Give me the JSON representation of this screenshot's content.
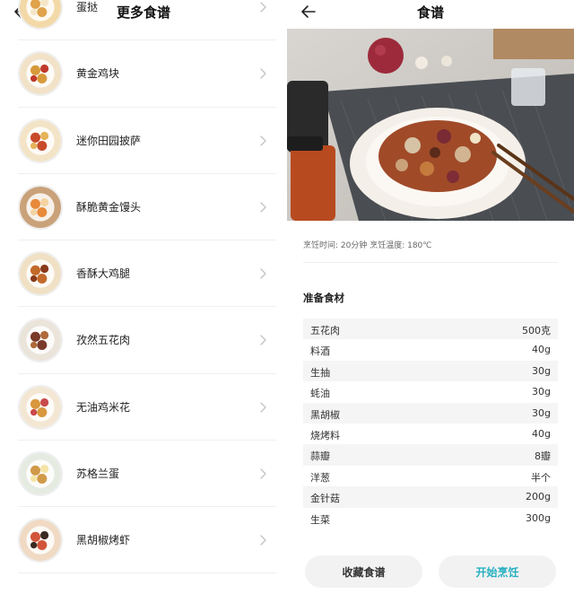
{
  "left": {
    "title": "更多食谱",
    "recipes": [
      {
        "label": "蛋挞",
        "thumb": "egg-tart"
      },
      {
        "label": "黄金鸡块",
        "thumb": "chicken-nuggets"
      },
      {
        "label": "迷你田园披萨",
        "thumb": "mini-pizza"
      },
      {
        "label": "酥脆黄金馒头",
        "thumb": "fried-buns"
      },
      {
        "label": "香酥大鸡腿",
        "thumb": "chicken-drumsticks"
      },
      {
        "label": "孜然五花肉",
        "thumb": "cumin-pork"
      },
      {
        "label": "无油鸡米花",
        "thumb": "popcorn-chicken"
      },
      {
        "label": "苏格兰蛋",
        "thumb": "scotch-egg"
      },
      {
        "label": "黑胡椒烤虾",
        "thumb": "pepper-shrimp"
      }
    ]
  },
  "right": {
    "title": "食谱",
    "meta": "烹饪时间: 20分钟 烹饪温度: 180℃",
    "section_title": "准备食材",
    "ingredients": [
      {
        "name": "五花肉",
        "qty": "500克"
      },
      {
        "name": "料酒",
        "qty": "40g"
      },
      {
        "name": "生抽",
        "qty": "30g"
      },
      {
        "name": "蚝油",
        "qty": "30g"
      },
      {
        "name": "黑胡椒",
        "qty": "30g"
      },
      {
        "name": "烧烤料",
        "qty": "40g"
      },
      {
        "name": "蒜瓣",
        "qty": "8瓣"
      },
      {
        "name": "洋葱",
        "qty": "半个"
      },
      {
        "name": "金针菇",
        "qty": "200g"
      },
      {
        "name": "生菜",
        "qty": "300g"
      }
    ],
    "save_label": "收藏食谱",
    "start_label": "开始烹饪"
  },
  "colors": {
    "accent": "#27b0c0",
    "row_stripe": "#f5f5f5",
    "button_bg": "#f2f2f2"
  }
}
